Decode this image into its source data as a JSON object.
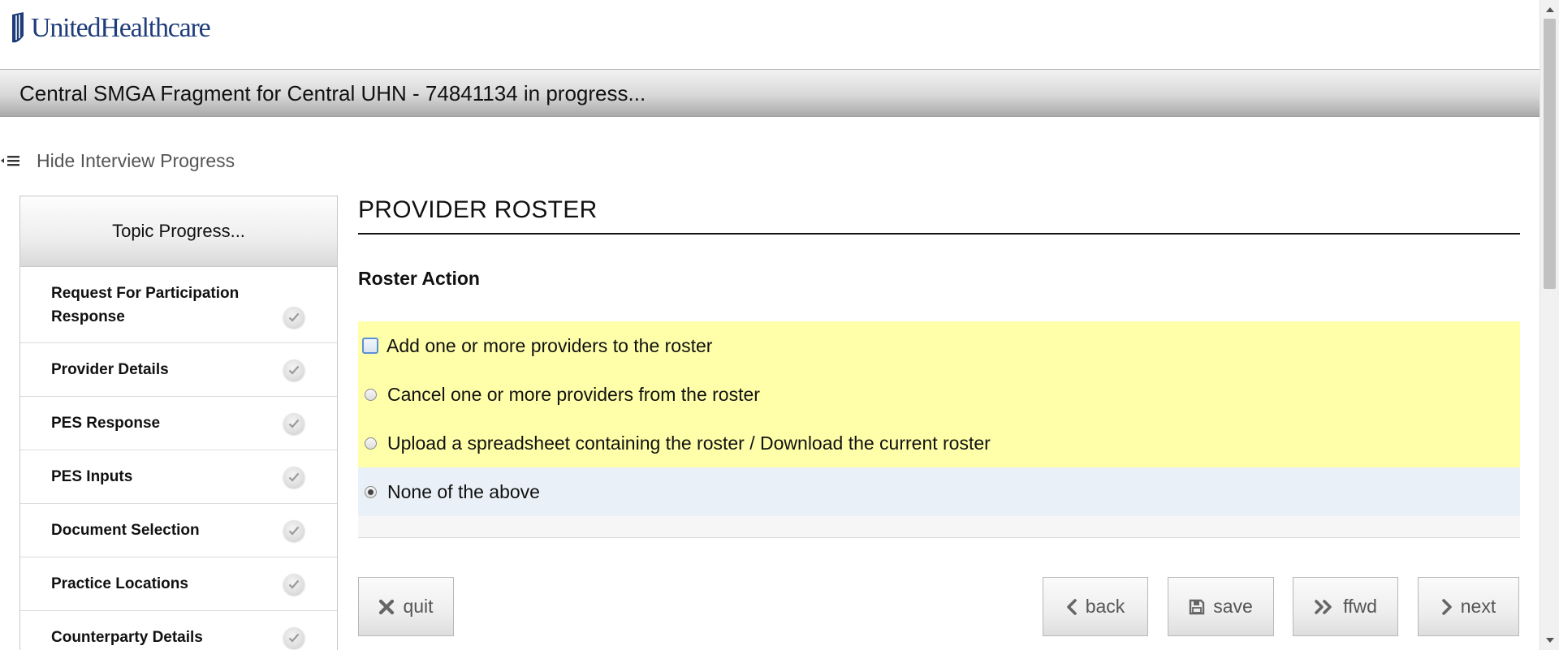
{
  "brand": {
    "logo_text": "UnitedHealthcare",
    "logo_color": "#1f3d7a"
  },
  "header": {
    "title": "Central SMGA Fragment for Central UHN - 74841134 in progress..."
  },
  "progress_toggle": {
    "label": "Hide Interview Progress",
    "icon": "collapse-list-icon"
  },
  "sidebar": {
    "title": "Topic Progress...",
    "items": [
      {
        "label": "Request For Participation Response",
        "status": "complete",
        "icon": "check-icon"
      },
      {
        "label": "Provider Details",
        "status": "complete",
        "icon": "check-icon"
      },
      {
        "label": "PES Response",
        "status": "complete",
        "icon": "check-icon"
      },
      {
        "label": "PES Inputs",
        "status": "complete",
        "icon": "check-icon"
      },
      {
        "label": "Document Selection",
        "status": "complete",
        "icon": "check-icon"
      },
      {
        "label": "Practice Locations",
        "status": "complete",
        "icon": "check-icon"
      },
      {
        "label": "Counterparty Details",
        "status": "complete",
        "icon": "check-icon"
      }
    ]
  },
  "main": {
    "heading": "PROVIDER ROSTER",
    "section_label": "Roster Action",
    "options": [
      {
        "label": "Add one or more providers to the roster",
        "checked": false,
        "focused": true
      },
      {
        "label": "Cancel one or more providers from the roster",
        "checked": false,
        "focused": false
      },
      {
        "label": "Upload a spreadsheet containing the roster / Download the current roster",
        "checked": false,
        "focused": false
      },
      {
        "label": "None of the above",
        "checked": true,
        "focused": false
      }
    ],
    "highlight_color": "#ffffaa",
    "selected_color": "#eaf0f7"
  },
  "nav": {
    "quit": {
      "label": "quit",
      "icon": "close-icon"
    },
    "back": {
      "label": "back",
      "icon": "chevron-left-icon"
    },
    "save": {
      "label": "save",
      "icon": "floppy-disk-icon"
    },
    "ffwd": {
      "label": "ffwd",
      "icon": "fast-forward-icon"
    },
    "next": {
      "label": "next",
      "icon": "chevron-right-icon"
    }
  }
}
